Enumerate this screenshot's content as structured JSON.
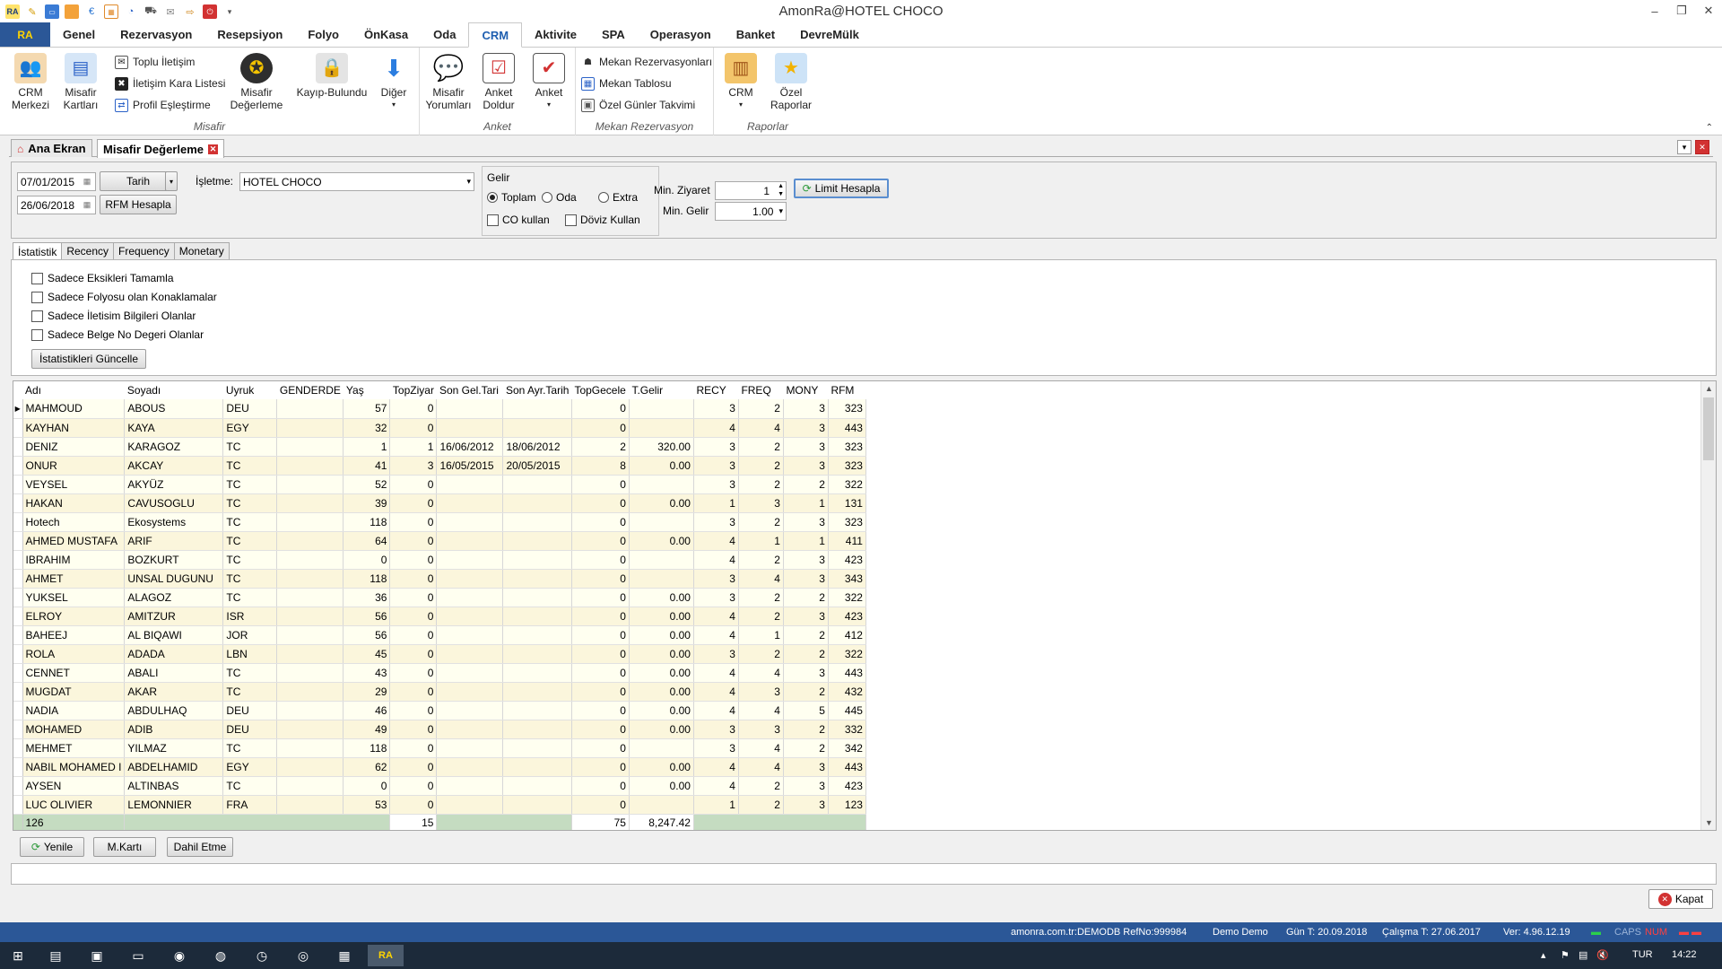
{
  "window": {
    "title": "AmonRa@HOTEL CHOCO",
    "app_badge": "RA"
  },
  "ribbon_tabs": [
    "Genel",
    "Rezervasyon",
    "Resepsiyon",
    "Folyo",
    "ÖnKasa",
    "Oda",
    "CRM",
    "Aktivite",
    "SPA",
    "Operasyon",
    "Banket",
    "DevreMülk"
  ],
  "active_ribbon_tab": "CRM",
  "ribbon": {
    "misafir": {
      "label": "Misafir",
      "crm_merkezi": "CRM Merkezi",
      "misafir_kartlari": "Misafir Kartları",
      "toplu_iletisim": "Toplu İletişim",
      "kara_liste": "İletişim Kara Listesi",
      "profil_eslestirme": "Profil Eşleştirme",
      "misafir_degerleme": "Misafir Değerleme",
      "kayip_bulundu": "Kayıp-Bulundu",
      "diger": "Diğer"
    },
    "anket": {
      "label": "Anket",
      "misafir_yorumlari": "Misafir Yorumları",
      "anket_doldur": "Anket Doldur",
      "anket": "Anket"
    },
    "mekan": {
      "label": "Mekan Rezervasyon",
      "mekan_rezervasyonlari": "Mekan Rezervasyonları",
      "mekan_tablosu": "Mekan Tablosu",
      "ozel_gunler": "Özel Günler Takvimi"
    },
    "raporlar": {
      "label": "Raporlar",
      "crm": "CRM",
      "ozel_raporlar": "Özel Raporlar"
    }
  },
  "doc_tabs": {
    "home": "Ana Ekran",
    "active": "Misafir Değerleme"
  },
  "filters": {
    "date_from": "07/01/2015",
    "date_to": "26/06/2018",
    "date_type": "Tarih",
    "rfm_button": "RFM Hesapla",
    "isletme_label": "İşletme:",
    "isletme_value": "HOTEL CHOCO",
    "gelir_label": "Gelir",
    "gelir_options": [
      "Toplam",
      "Oda",
      "Extra"
    ],
    "gelir_selected": "Toplam",
    "co_kullan": "CO kullan",
    "doviz_kullan": "Döviz Kullan",
    "min_ziyaret_label": "Min. Ziyaret",
    "min_ziyaret_value": "1",
    "min_gelir_label": "Min. Gelir",
    "min_gelir_value": "1.00",
    "limit_button": "Limit Hesapla"
  },
  "inner_tabs": [
    "İstatistik",
    "Recency",
    "Frequency",
    "Monetary"
  ],
  "statistics": {
    "checkboxes": [
      "Sadece Eksikleri Tamamla",
      "Sadece Folyosu olan Konaklamalar",
      "Sadece İletisim Bilgileri Olanlar",
      "Sadece Belge No Degeri Olanlar"
    ],
    "update_button": "İstatistikleri Güncelle"
  },
  "grid": {
    "columns": [
      "Adı",
      "Soyadı",
      "Uyruk",
      "GENDERDE",
      "Yaş",
      "TopZiyar",
      "Son Gel.Tari",
      "Son Ayr.Tarih",
      "TopGecele",
      "T.Gelir",
      "RECY",
      "FREQ",
      "MONY",
      "RFM"
    ],
    "rows": [
      [
        "MAHMOUD",
        "ABOUS",
        "DEU",
        "",
        "57",
        "0",
        "",
        "",
        "0",
        "",
        "3",
        "2",
        "3",
        "323"
      ],
      [
        "KAYHAN",
        "KAYA",
        "EGY",
        "",
        "32",
        "0",
        "",
        "",
        "0",
        "",
        "4",
        "4",
        "3",
        "443"
      ],
      [
        "DENIZ",
        "KARAGOZ",
        "TC",
        "",
        "1",
        "1",
        "16/06/2012",
        "18/06/2012",
        "2",
        "320.00",
        "3",
        "2",
        "3",
        "323"
      ],
      [
        "ONUR",
        "AKCAY",
        "TC",
        "",
        "41",
        "3",
        "16/05/2015",
        "20/05/2015",
        "8",
        "0.00",
        "3",
        "2",
        "3",
        "323"
      ],
      [
        "VEYSEL",
        "AKYÜZ",
        "TC",
        "",
        "52",
        "0",
        "",
        "",
        "0",
        "",
        "3",
        "2",
        "2",
        "322"
      ],
      [
        "HAKAN",
        "CAVUSOGLU",
        "TC",
        "",
        "39",
        "0",
        "",
        "",
        "0",
        "0.00",
        "1",
        "3",
        "1",
        "131"
      ],
      [
        "Hotech",
        "Ekosystems",
        "TC",
        "",
        "118",
        "0",
        "",
        "",
        "0",
        "",
        "3",
        "2",
        "3",
        "323"
      ],
      [
        "AHMED MUSTAFA",
        "ARIF",
        "TC",
        "",
        "64",
        "0",
        "",
        "",
        "0",
        "0.00",
        "4",
        "1",
        "1",
        "411"
      ],
      [
        "IBRAHIM",
        "BOZKURT",
        "TC",
        "",
        "0",
        "0",
        "",
        "",
        "0",
        "",
        "4",
        "2",
        "3",
        "423"
      ],
      [
        "AHMET",
        " UNSAL DUGUNU",
        "TC",
        "",
        "118",
        "0",
        "",
        "",
        "0",
        "",
        "3",
        "4",
        "3",
        "343"
      ],
      [
        "YUKSEL",
        "ALAGOZ",
        "TC",
        "",
        "36",
        "0",
        "",
        "",
        "0",
        "0.00",
        "3",
        "2",
        "2",
        "322"
      ],
      [
        "ELROY",
        "AMITZUR",
        "ISR",
        "",
        "56",
        "0",
        "",
        "",
        "0",
        "0.00",
        "4",
        "2",
        "3",
        "423"
      ],
      [
        "BAHEEJ",
        "AL BIQAWI",
        "JOR",
        "",
        "56",
        "0",
        "",
        "",
        "0",
        "0.00",
        "4",
        "1",
        "2",
        "412"
      ],
      [
        "ROLA",
        "ADADA",
        "LBN",
        "",
        "45",
        "0",
        "",
        "",
        "0",
        "0.00",
        "3",
        "2",
        "2",
        "322"
      ],
      [
        "CENNET",
        "ABALI",
        "TC",
        "",
        "43",
        "0",
        "",
        "",
        "0",
        "0.00",
        "4",
        "4",
        "3",
        "443"
      ],
      [
        "MUGDAT",
        "AKAR",
        "TC",
        "",
        "29",
        "0",
        "",
        "",
        "0",
        "0.00",
        "4",
        "3",
        "2",
        "432"
      ],
      [
        "NADIA",
        "ABDULHAQ",
        "DEU",
        "",
        "46",
        "0",
        "",
        "",
        "0",
        "0.00",
        "4",
        "4",
        "5",
        "445"
      ],
      [
        "MOHAMED",
        "ADIB",
        "DEU",
        "",
        "49",
        "0",
        "",
        "",
        "0",
        "0.00",
        "3",
        "3",
        "2",
        "332"
      ],
      [
        "MEHMET",
        " YILMAZ",
        "TC",
        "",
        "118",
        "0",
        "",
        "",
        "0",
        "",
        "3",
        "4",
        "2",
        "342"
      ],
      [
        "NABIL MOHAMED I",
        "ABDELHAMID",
        "EGY",
        "",
        "62",
        "0",
        "",
        "",
        "0",
        "0.00",
        "4",
        "4",
        "3",
        "443"
      ],
      [
        "AYSEN",
        "ALTINBAS",
        "TC",
        "",
        "0",
        "0",
        "",
        "",
        "0",
        "0.00",
        "4",
        "2",
        "3",
        "423"
      ],
      [
        "LUC OLIVIER",
        "LEMONNIER",
        "FRA",
        "",
        "53",
        "0",
        "",
        "",
        "0",
        "",
        "1",
        "2",
        "3",
        "123"
      ]
    ],
    "footer": {
      "count": "126",
      "top_ziyaret": "15",
      "top_gecele": "75",
      "t_gelir": "8,247.42"
    }
  },
  "buttons": {
    "yenile": "Yenile",
    "mkarti": "M.Kartı",
    "dahil_etme": "Dahil Etme",
    "kapat": "Kapat"
  },
  "statusbar": {
    "db": "amonra.com.tr:DEMODB RefNo:999984",
    "user": "Demo Demo",
    "gun": "Gün T: 20.09.2018",
    "calisma": "Çalışma T: 27.06.2017",
    "version": "Ver: 4.96.12.19",
    "caps": "CAPS",
    "num": "NUM"
  },
  "taskbar": {
    "lang": "TUR",
    "time": "14:22",
    "active_app": "RA"
  },
  "colors": {
    "accent": "#2b5797",
    "row_odd": "#fffff0",
    "row_even": "#fbf6dc",
    "footer_green": "#c5dcc1"
  }
}
